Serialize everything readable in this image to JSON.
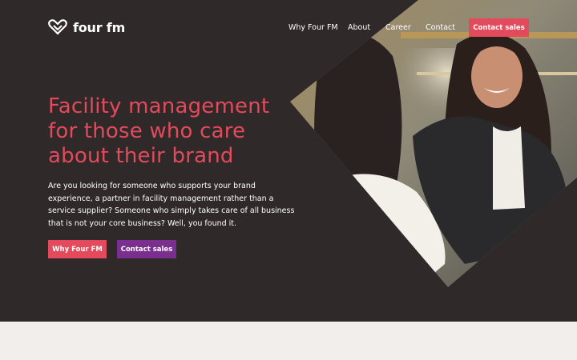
{
  "brand": {
    "name": "four fm",
    "logo_icon": "heart-logo-icon"
  },
  "nav": {
    "items": [
      {
        "label": "Why Four FM"
      },
      {
        "label": "About"
      },
      {
        "label": "Career"
      },
      {
        "label": "Contact"
      }
    ],
    "cta_label": "Contact sales"
  },
  "hero": {
    "headline": "Facility management for those who care about their brand",
    "intro": "Are you looking for someone who supports your brand experience, a partner in facility management rather than a service supplier? Someone who simply takes care of all business that is not your core business? Well, you found it.",
    "primary_button": "Why Four FM",
    "secondary_button": "Contact sales"
  },
  "colors": {
    "hero_bg": "#2f2a29",
    "accent": "#e34a5b",
    "purple": "#7a2f8f",
    "page_bg": "#f2eeeb"
  }
}
